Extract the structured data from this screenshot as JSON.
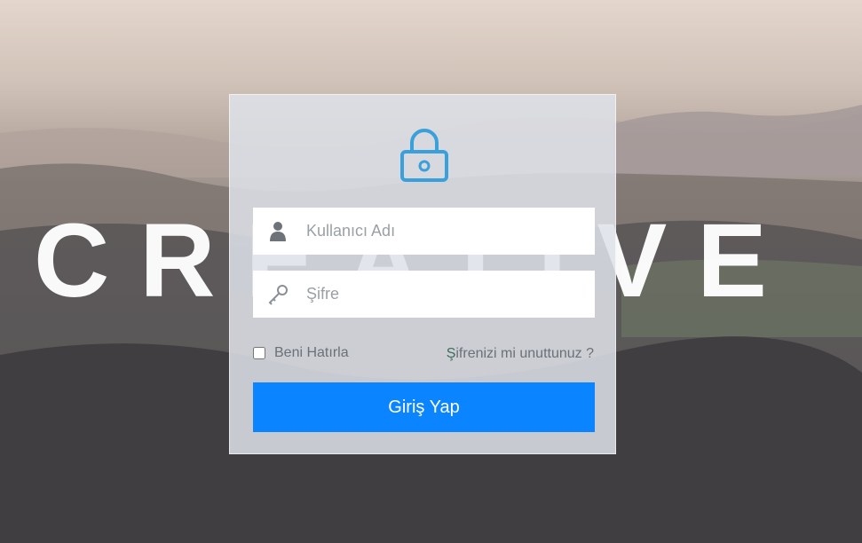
{
  "background": {
    "brand_word": "CREATIVE"
  },
  "login_form": {
    "username_placeholder": "Kullanıcı Adı",
    "password_placeholder": "Şifre",
    "remember_label": "Beni Hatırla",
    "remember_checked": false,
    "forgot_link": "Şifrenizi mi unuttunuz ?",
    "submit_label": "Giriş Yap"
  },
  "icons": {
    "lock": "lock-icon",
    "user": "user-icon",
    "key": "key-icon"
  },
  "colors": {
    "accent": "#0a84ff",
    "lock_stroke": "#3aa0dc",
    "panel_bg": "#dee2e9"
  }
}
